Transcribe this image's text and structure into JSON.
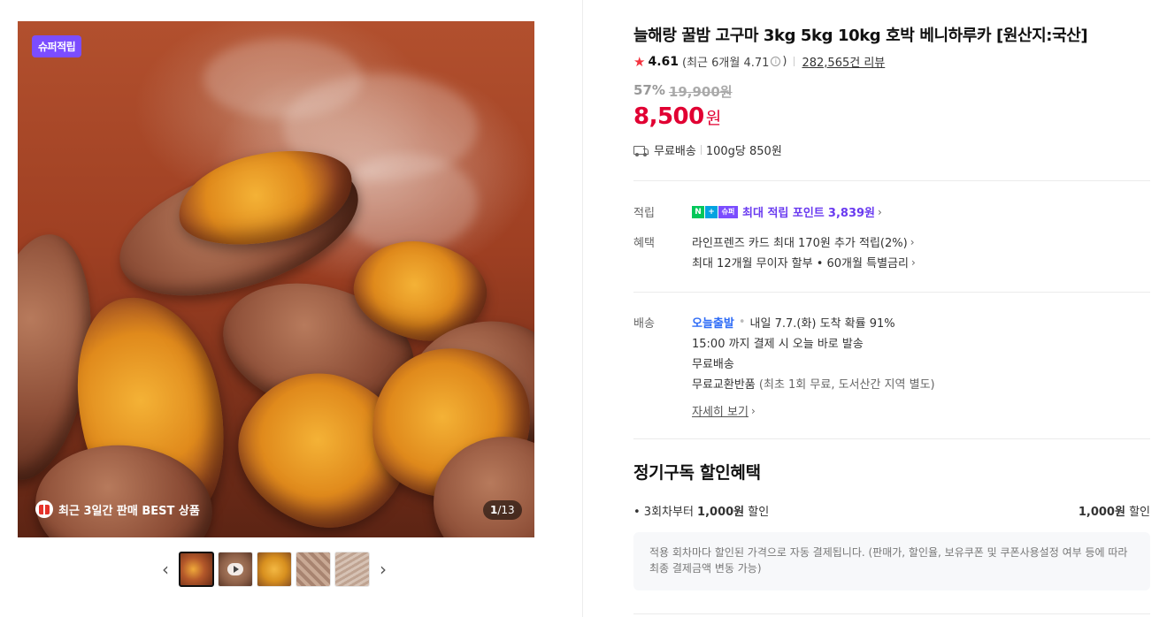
{
  "gallery": {
    "badge": "슈퍼적립",
    "best_label": "최근 3일간 판매 BEST 상품",
    "counter_current": "1",
    "counter_total": "/13",
    "prev_icon": "chevron-left-icon",
    "next_icon": "chevron-right-icon",
    "thumbnail_count": 5
  },
  "product": {
    "title": "늘해랑 꿀밤 고구마 3kg 5kg 10kg 호박 베니하루카 [원산지:국산]",
    "rating": "4.61",
    "rating_recent": "(최근 6개월 4.71",
    "rating_recent_close": ")",
    "review_count": "282,565건 리뷰",
    "discount_rate": "57%",
    "original_price": "19,900원",
    "price": "8,500",
    "price_unit": "원",
    "shipping": "무료배송",
    "unit_price": "100g당 850원"
  },
  "benefits": {
    "points_label": "적립",
    "points_badges": [
      "N",
      "+",
      "슈퍼"
    ],
    "points_text": "최대 적립 포인트",
    "points_value": "3,839원",
    "benefit_label": "혜택",
    "card_benefit": "라인프렌즈 카드 최대 170원 추가 적립(2%)",
    "installment": "최대 12개월 무이자 할부 • 60개월 특별금리"
  },
  "delivery": {
    "label": "배송",
    "today_label": "오늘출발",
    "arrival": "내일 7.7.(화) 도착 확률 91%",
    "cutoff": "15:00 까지 결제 시 오늘 바로 발송",
    "free_shipping": "무료배송",
    "return_label": "무료교환반품",
    "return_detail": "(최초 1회 무료, 도서산간 지역 별도)",
    "detail_link": "자세히 보기"
  },
  "subscription": {
    "title": "정기구독 할인혜택",
    "condition_prefix": "• 3회차부터 ",
    "condition_amount": "1,000원",
    "condition_suffix": " 할인",
    "discount_amount": "1,000원",
    "discount_suffix": " 할인",
    "notice": "적용 회차마다 할인된 가격으로 자동 결제됩니다. (판매가, 할인율, 보유쿠폰 및 쿠폰사용설정 여부 등에 따라 최종 결제금액 변동 가능)"
  },
  "colors": {
    "price_red": "#e10032",
    "super_purple": "#7b4dff",
    "today_blue": "#2f6cf6",
    "star_red": "#f4333f",
    "naver_green": "#03c75a"
  }
}
